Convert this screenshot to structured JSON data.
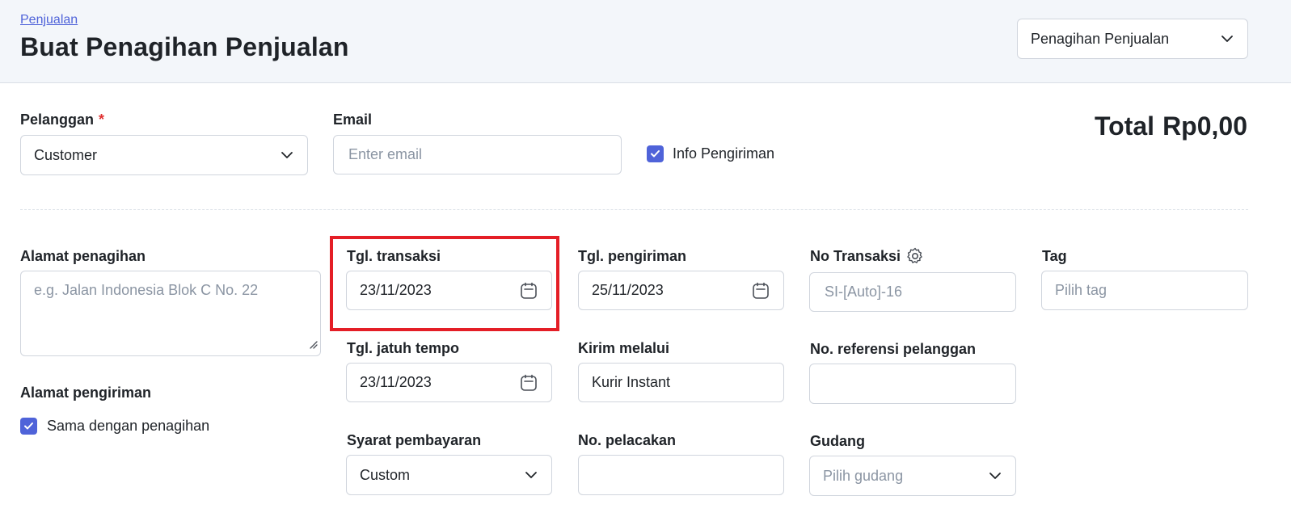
{
  "header": {
    "breadcrumb": "Penjualan",
    "title": "Buat Penagihan Penjualan",
    "type_select": {
      "value": "Penagihan Penjualan",
      "icon": "chevron-down-icon"
    }
  },
  "total": {
    "label": "Total",
    "value": "Rp0,00"
  },
  "customer": {
    "label": "Pelanggan",
    "required_mark": "*",
    "value": "Customer"
  },
  "email": {
    "label": "Email",
    "placeholder": "Enter email"
  },
  "info_pengiriman": {
    "label": "Info Pengiriman",
    "checked": true
  },
  "billing_address": {
    "label": "Alamat penagihan",
    "placeholder": "e.g. Jalan Indonesia Blok C No. 22"
  },
  "shipping_address": {
    "label": "Alamat pengiriman",
    "same_as_billing_label": "Sama dengan penagihan",
    "checked": true
  },
  "transaction_date": {
    "label": "Tgl. transaksi",
    "value": "23/11/2023"
  },
  "due_date": {
    "label": "Tgl. jatuh tempo",
    "value": "23/11/2023"
  },
  "payment_terms": {
    "label": "Syarat pembayaran",
    "value": "Custom"
  },
  "shipping_date": {
    "label": "Tgl. pengiriman",
    "value": "25/11/2023"
  },
  "ship_via": {
    "label": "Kirim melalui",
    "value": "Kurir Instant"
  },
  "tracking_no": {
    "label": "No. pelacakan",
    "value": ""
  },
  "transaction_no": {
    "label": "No Transaksi",
    "placeholder": "SI-[Auto]-16"
  },
  "customer_ref": {
    "label": "No. referensi pelanggan",
    "value": ""
  },
  "warehouse": {
    "label": "Gudang",
    "placeholder": "Pilih gudang"
  },
  "tag": {
    "label": "Tag",
    "placeholder": "Pilih tag"
  },
  "colors": {
    "accent": "#4f63d9",
    "highlight": "#e41e26",
    "header_bg": "#f3f6fa"
  }
}
